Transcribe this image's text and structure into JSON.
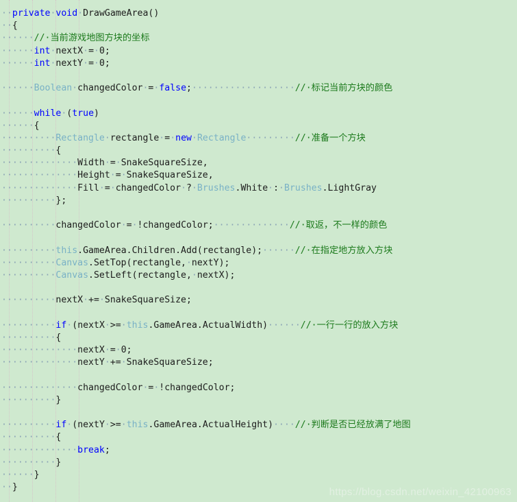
{
  "editor": {
    "background_color": "#cfe9cf",
    "language": "csharp",
    "indent_guide_color": "#d8b9c8",
    "whitespace_dot_color": "#8aa3b5",
    "colors": {
      "keyword": "#0000ff",
      "type": "#79b1c6",
      "comment": "#1c7a1c",
      "plain": "#1c1c1c"
    }
  },
  "watermark": {
    "text": "https://blog.csdn.net/weixin_42100963"
  },
  "code": {
    "lines": [
      [
        {
          "t": "dot",
          "v": "··"
        },
        {
          "t": "kw",
          "v": "private"
        },
        {
          "t": "dot",
          "v": "·"
        },
        {
          "t": "kw",
          "v": "void"
        },
        {
          "t": "dot",
          "v": "·"
        },
        {
          "t": "plain",
          "v": "DrawGameArea()"
        }
      ],
      [
        {
          "t": "dot",
          "v": "··"
        },
        {
          "t": "brace",
          "v": "{"
        }
      ],
      [
        {
          "t": "dot",
          "v": "······"
        },
        {
          "t": "cmt",
          "v": "//·当前游戏地图方块的坐标"
        }
      ],
      [
        {
          "t": "dot",
          "v": "······"
        },
        {
          "t": "kw",
          "v": "int"
        },
        {
          "t": "dot",
          "v": "·"
        },
        {
          "t": "plain",
          "v": "nextX"
        },
        {
          "t": "dot",
          "v": "·"
        },
        {
          "t": "plain",
          "v": "="
        },
        {
          "t": "dot",
          "v": "·"
        },
        {
          "t": "num",
          "v": "0;"
        }
      ],
      [
        {
          "t": "dot",
          "v": "······"
        },
        {
          "t": "kw",
          "v": "int"
        },
        {
          "t": "dot",
          "v": "·"
        },
        {
          "t": "plain",
          "v": "nextY"
        },
        {
          "t": "dot",
          "v": "·"
        },
        {
          "t": "plain",
          "v": "="
        },
        {
          "t": "dot",
          "v": "·"
        },
        {
          "t": "num",
          "v": "0;"
        }
      ],
      [],
      [
        {
          "t": "dot",
          "v": "······"
        },
        {
          "t": "type",
          "v": "Boolean"
        },
        {
          "t": "dot",
          "v": "·"
        },
        {
          "t": "plain",
          "v": "changedColor"
        },
        {
          "t": "dot",
          "v": "·"
        },
        {
          "t": "plain",
          "v": "="
        },
        {
          "t": "dot",
          "v": "·"
        },
        {
          "t": "kw",
          "v": "false"
        },
        {
          "t": "plain",
          "v": ";"
        },
        {
          "t": "dot",
          "v": "···················"
        },
        {
          "t": "cmt",
          "v": "//·标记当前方块的颜色"
        }
      ],
      [],
      [
        {
          "t": "dot",
          "v": "······"
        },
        {
          "t": "kw",
          "v": "while"
        },
        {
          "t": "dot",
          "v": "·"
        },
        {
          "t": "plain",
          "v": "("
        },
        {
          "t": "kw",
          "v": "true"
        },
        {
          "t": "plain",
          "v": ")"
        }
      ],
      [
        {
          "t": "dot",
          "v": "······"
        },
        {
          "t": "brace",
          "v": "{"
        }
      ],
      [
        {
          "t": "dot",
          "v": "··········"
        },
        {
          "t": "type",
          "v": "Rectangle"
        },
        {
          "t": "dot",
          "v": "·"
        },
        {
          "t": "plain",
          "v": "rectangle"
        },
        {
          "t": "dot",
          "v": "·"
        },
        {
          "t": "plain",
          "v": "="
        },
        {
          "t": "dot",
          "v": "·"
        },
        {
          "t": "kw",
          "v": "new"
        },
        {
          "t": "dot",
          "v": "·"
        },
        {
          "t": "type",
          "v": "Rectangle"
        },
        {
          "t": "dot",
          "v": "·········"
        },
        {
          "t": "cmt",
          "v": "//·准备一个方块"
        }
      ],
      [
        {
          "t": "dot",
          "v": "··········"
        },
        {
          "t": "brace",
          "v": "{"
        }
      ],
      [
        {
          "t": "dot",
          "v": "··············"
        },
        {
          "t": "plain",
          "v": "Width"
        },
        {
          "t": "dot",
          "v": "·"
        },
        {
          "t": "plain",
          "v": "="
        },
        {
          "t": "dot",
          "v": "·"
        },
        {
          "t": "plain",
          "v": "SnakeSquareSize,"
        }
      ],
      [
        {
          "t": "dot",
          "v": "··············"
        },
        {
          "t": "plain",
          "v": "Height"
        },
        {
          "t": "dot",
          "v": "·"
        },
        {
          "t": "plain",
          "v": "="
        },
        {
          "t": "dot",
          "v": "·"
        },
        {
          "t": "plain",
          "v": "SnakeSquareSize,"
        }
      ],
      [
        {
          "t": "dot",
          "v": "··············"
        },
        {
          "t": "plain",
          "v": "Fill"
        },
        {
          "t": "dot",
          "v": "·"
        },
        {
          "t": "plain",
          "v": "="
        },
        {
          "t": "dot",
          "v": "·"
        },
        {
          "t": "plain",
          "v": "changedColor"
        },
        {
          "t": "dot",
          "v": "·"
        },
        {
          "t": "plain",
          "v": "?"
        },
        {
          "t": "dot",
          "v": "·"
        },
        {
          "t": "type",
          "v": "Brushes"
        },
        {
          "t": "plain",
          "v": ".White"
        },
        {
          "t": "dot",
          "v": "·"
        },
        {
          "t": "plain",
          "v": ":"
        },
        {
          "t": "dot",
          "v": "·"
        },
        {
          "t": "type",
          "v": "Brushes"
        },
        {
          "t": "plain",
          "v": ".LightGray"
        }
      ],
      [
        {
          "t": "dot",
          "v": "··········"
        },
        {
          "t": "brace",
          "v": "};"
        }
      ],
      [],
      [
        {
          "t": "dot",
          "v": "··········"
        },
        {
          "t": "plain",
          "v": "changedColor"
        },
        {
          "t": "dot",
          "v": "·"
        },
        {
          "t": "plain",
          "v": "="
        },
        {
          "t": "dot",
          "v": "·"
        },
        {
          "t": "plain",
          "v": "!changedColor;"
        },
        {
          "t": "dot",
          "v": "··············"
        },
        {
          "t": "cmt",
          "v": "//·取返，不一样的颜色"
        }
      ],
      [],
      [
        {
          "t": "dot",
          "v": "··········"
        },
        {
          "t": "type",
          "v": "this"
        },
        {
          "t": "plain",
          "v": ".GameArea.Children.Add(rectangle);"
        },
        {
          "t": "dot",
          "v": "······"
        },
        {
          "t": "cmt",
          "v": "//·在指定地方放入方块"
        }
      ],
      [
        {
          "t": "dot",
          "v": "··········"
        },
        {
          "t": "type",
          "v": "Canvas"
        },
        {
          "t": "plain",
          "v": ".SetTop(rectangle,"
        },
        {
          "t": "dot",
          "v": "·"
        },
        {
          "t": "plain",
          "v": "nextY);"
        }
      ],
      [
        {
          "t": "dot",
          "v": "··········"
        },
        {
          "t": "type",
          "v": "Canvas"
        },
        {
          "t": "plain",
          "v": ".SetLeft(rectangle,"
        },
        {
          "t": "dot",
          "v": "·"
        },
        {
          "t": "plain",
          "v": "nextX);"
        }
      ],
      [],
      [
        {
          "t": "dot",
          "v": "··········"
        },
        {
          "t": "plain",
          "v": "nextX"
        },
        {
          "t": "dot",
          "v": "·"
        },
        {
          "t": "plain",
          "v": "+="
        },
        {
          "t": "dot",
          "v": "·"
        },
        {
          "t": "plain",
          "v": "SnakeSquareSize;"
        }
      ],
      [],
      [
        {
          "t": "dot",
          "v": "··········"
        },
        {
          "t": "kw",
          "v": "if"
        },
        {
          "t": "dot",
          "v": "·"
        },
        {
          "t": "plain",
          "v": "(nextX"
        },
        {
          "t": "dot",
          "v": "·"
        },
        {
          "t": "plain",
          "v": ">="
        },
        {
          "t": "dot",
          "v": "·"
        },
        {
          "t": "type",
          "v": "this"
        },
        {
          "t": "plain",
          "v": ".GameArea.ActualWidth)"
        },
        {
          "t": "dot",
          "v": "······"
        },
        {
          "t": "cmt",
          "v": "//·一行一行的放入方块"
        }
      ],
      [
        {
          "t": "dot",
          "v": "··········"
        },
        {
          "t": "brace",
          "v": "{"
        }
      ],
      [
        {
          "t": "dot",
          "v": "··············"
        },
        {
          "t": "plain",
          "v": "nextX"
        },
        {
          "t": "dot",
          "v": "·"
        },
        {
          "t": "plain",
          "v": "="
        },
        {
          "t": "dot",
          "v": "·"
        },
        {
          "t": "num",
          "v": "0;"
        }
      ],
      [
        {
          "t": "dot",
          "v": "··············"
        },
        {
          "t": "plain",
          "v": "nextY"
        },
        {
          "t": "dot",
          "v": "·"
        },
        {
          "t": "plain",
          "v": "+="
        },
        {
          "t": "dot",
          "v": "·"
        },
        {
          "t": "plain",
          "v": "SnakeSquareSize;"
        }
      ],
      [],
      [
        {
          "t": "dot",
          "v": "··············"
        },
        {
          "t": "plain",
          "v": "changedColor"
        },
        {
          "t": "dot",
          "v": "·"
        },
        {
          "t": "plain",
          "v": "="
        },
        {
          "t": "dot",
          "v": "·"
        },
        {
          "t": "plain",
          "v": "!changedColor;"
        }
      ],
      [
        {
          "t": "dot",
          "v": "··········"
        },
        {
          "t": "brace",
          "v": "}"
        }
      ],
      [],
      [
        {
          "t": "dot",
          "v": "··········"
        },
        {
          "t": "kw",
          "v": "if"
        },
        {
          "t": "dot",
          "v": "·"
        },
        {
          "t": "plain",
          "v": "(nextY"
        },
        {
          "t": "dot",
          "v": "·"
        },
        {
          "t": "plain",
          "v": ">="
        },
        {
          "t": "dot",
          "v": "·"
        },
        {
          "t": "type",
          "v": "this"
        },
        {
          "t": "plain",
          "v": ".GameArea.ActualHeight)"
        },
        {
          "t": "dot",
          "v": "····"
        },
        {
          "t": "cmt",
          "v": "//·判断是否已经放满了地图"
        }
      ],
      [
        {
          "t": "dot",
          "v": "··········"
        },
        {
          "t": "brace",
          "v": "{"
        }
      ],
      [
        {
          "t": "dot",
          "v": "··············"
        },
        {
          "t": "kw",
          "v": "break"
        },
        {
          "t": "plain",
          "v": ";"
        }
      ],
      [
        {
          "t": "dot",
          "v": "··········"
        },
        {
          "t": "brace",
          "v": "}"
        }
      ],
      [
        {
          "t": "dot",
          "v": "······"
        },
        {
          "t": "brace",
          "v": "}"
        }
      ],
      [
        {
          "t": "dot",
          "v": "··"
        },
        {
          "t": "brace",
          "v": "}"
        }
      ]
    ]
  }
}
